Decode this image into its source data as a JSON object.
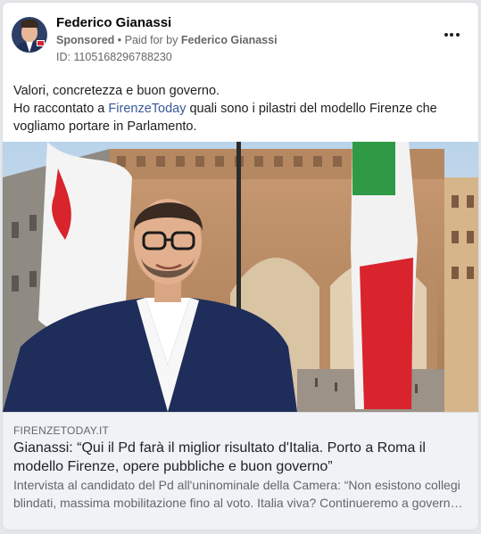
{
  "post": {
    "author_name": "Federico Gianassi",
    "sponsored_label": "Sponsored",
    "separator": " • ",
    "paid_for_prefix": "Paid for by ",
    "paid_for_name": "Federico Gianassi",
    "ad_id": "ID: 1105168296788230",
    "more_icon": "more-horizontal-icon",
    "text_line1": "Valori, concretezza e buon governo.",
    "text_line2_before": "Ho raccontato a ",
    "text_line2_link": "FirenzeToday",
    "text_line2_after": " quali sono i pilastri del modello Firenze che vogliamo portare in Parlamento."
  },
  "link_preview": {
    "domain": "FIRENZETODAY.IT",
    "headline": "Gianassi: “Qui il Pd farà il miglior risultato d'Italia. Porto a Roma il modello Firenze, opere pubbliche e buon governo”",
    "description_line1": "Intervista al candidato del Pd all'uninominale della Camera: “Non esistono collegi",
    "description_line2": "blindati, massima mobilitazione fino al voto. Italia viva? Continueremo a governare insieme”"
  },
  "colors": {
    "link": "#385898",
    "flag_green": "#2f9a45",
    "flag_red": "#d9232d"
  }
}
